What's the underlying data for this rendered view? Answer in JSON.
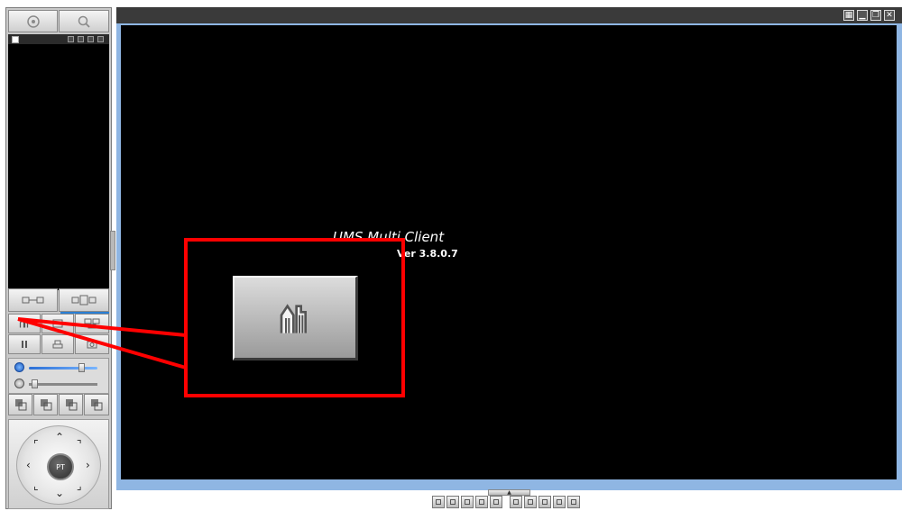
{
  "app": {
    "title": "UMS Multi Client",
    "version": "Ver 3.8.0.7"
  },
  "left_panel": {
    "top_buttons": [
      {
        "name": "camera-select",
        "icon": "target-icon"
      },
      {
        "name": "search",
        "icon": "magnifier-icon"
      }
    ],
    "ptz_center_label": "PT",
    "volume_level": 0.8,
    "mic_level": 0.05
  },
  "window_controls": [
    "layout",
    "minimize",
    "restore",
    "close"
  ],
  "colors": {
    "frame_blue": "#8fb6e3",
    "callout_red": "#ff0000",
    "video_bg": "#000000"
  }
}
